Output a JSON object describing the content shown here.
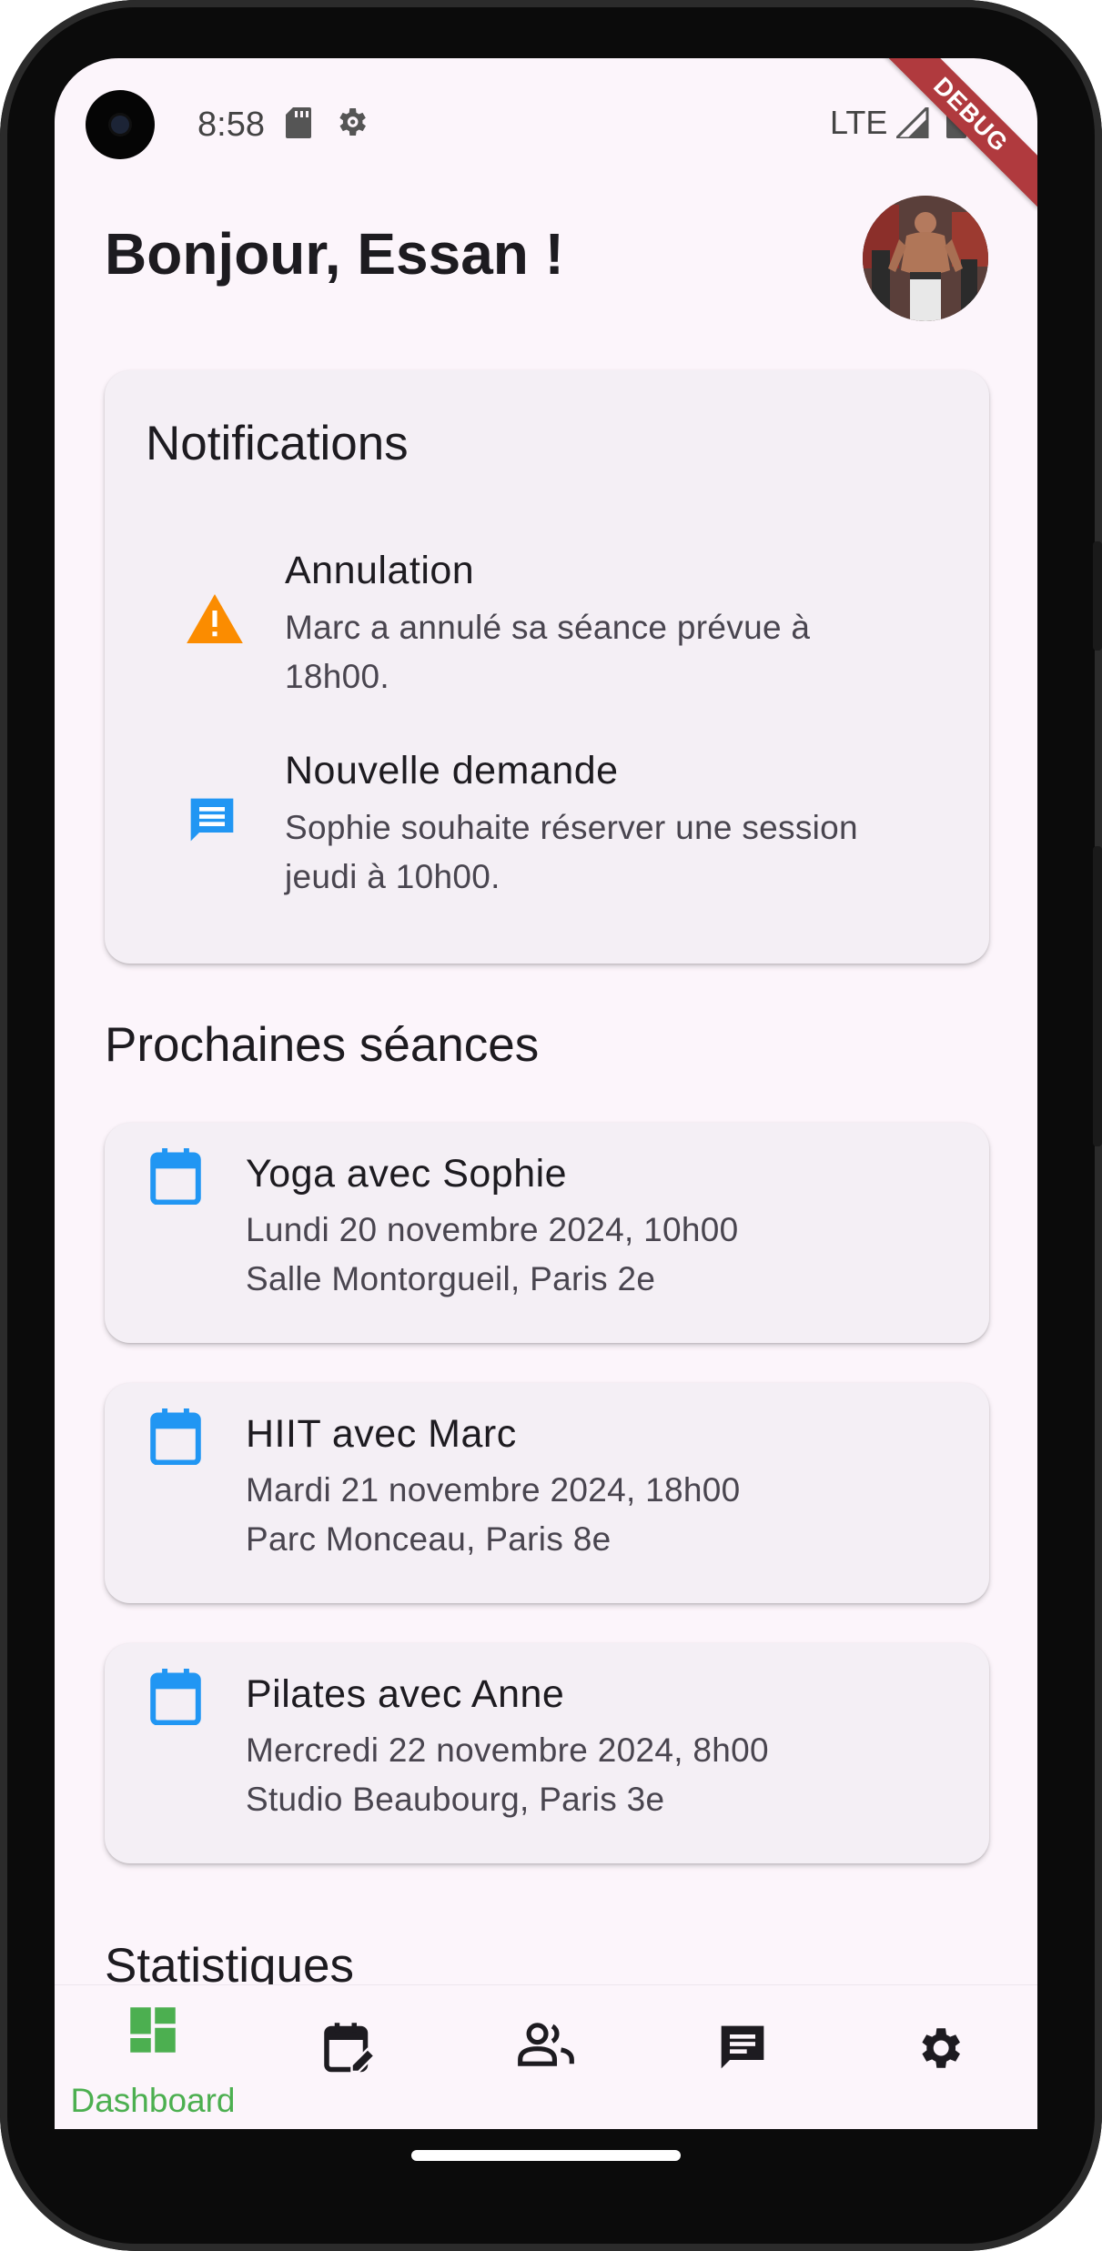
{
  "status_bar": {
    "time": "8:58",
    "network": "LTE",
    "debug_label": "DEBUG"
  },
  "header": {
    "greeting": "Bonjour, Essan !"
  },
  "notifications": {
    "title": "Notifications",
    "items": [
      {
        "icon": "warning-icon",
        "title": "Annulation",
        "description": "Marc a annulé sa séance prévue à 18h00."
      },
      {
        "icon": "chat-icon",
        "title": "Nouvelle demande",
        "description": "Sophie souhaite réserver une session jeudi à 10h00."
      }
    ]
  },
  "sessions": {
    "title": "Prochaines séances",
    "items": [
      {
        "title": "Yoga avec Sophie",
        "datetime": "Lundi 20 novembre 2024, 10h00",
        "location": "Salle Montorgueil, Paris 2e"
      },
      {
        "title": "HIIT avec Marc",
        "datetime": "Mardi 21 novembre 2024, 18h00",
        "location": "Parc Monceau, Paris 8e"
      },
      {
        "title": "Pilates avec Anne",
        "datetime": "Mercredi 22 novembre 2024, 8h00",
        "location": "Studio Beaubourg, Paris 3e"
      }
    ]
  },
  "stats": {
    "title": "Statistiques"
  },
  "bottom_nav": {
    "items": [
      {
        "icon": "dashboard-icon",
        "label": "Dashboard",
        "active": true
      },
      {
        "icon": "calendar-edit-icon",
        "label": "",
        "active": false
      },
      {
        "icon": "people-icon",
        "label": "",
        "active": false
      },
      {
        "icon": "chat-icon",
        "label": "",
        "active": false
      },
      {
        "icon": "settings-icon",
        "label": "",
        "active": false
      }
    ]
  },
  "colors": {
    "accent_active": "#4caf50",
    "warning": "#fb8c00",
    "info": "#2196f3",
    "background": "#fcf5fb",
    "card": "#f4eff5"
  }
}
